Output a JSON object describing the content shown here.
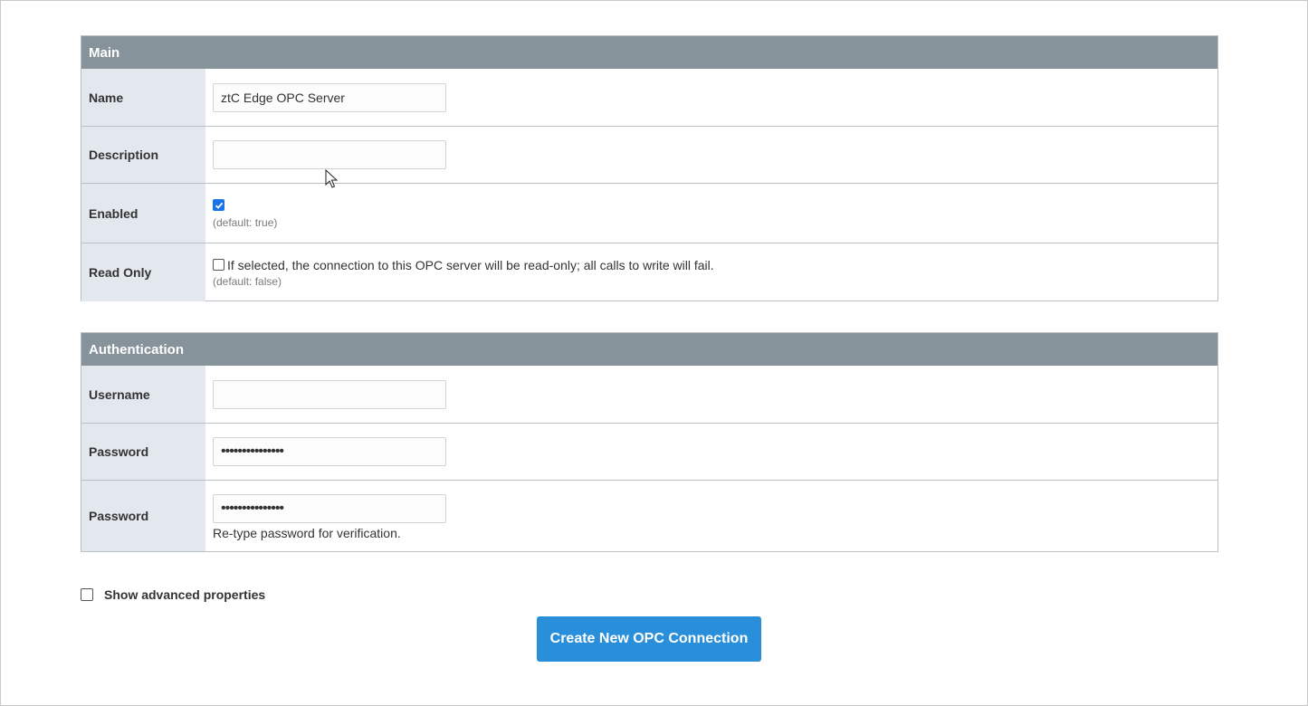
{
  "main_section": {
    "title": "Main",
    "name_label": "Name",
    "name_value": "ztC Edge OPC Server",
    "description_label": "Description",
    "description_value": "",
    "enabled_label": "Enabled",
    "enabled_checked": true,
    "enabled_default": "(default: true)",
    "read_only_label": "Read Only",
    "read_only_checked": false,
    "read_only_text": "If selected, the connection to this OPC server will be read-only; all calls to write will fail.",
    "read_only_default": "(default: false)"
  },
  "auth_section": {
    "title": "Authentication",
    "username_label": "Username",
    "username_value": "",
    "password_label": "Password",
    "password_value": "•••••••••••••••",
    "password_confirm_label": "Password",
    "password_confirm_value": "•••••••••••••••",
    "password_confirm_help": "Re-type password for verification."
  },
  "advanced": {
    "label": "Show advanced properties",
    "checked": false
  },
  "actions": {
    "create_label": "Create New OPC Connection"
  },
  "colors": {
    "header_bg": "#87939b",
    "label_bg": "#e3e8ee",
    "button_bg": "#2a8fdb",
    "checkbox_on": "#1a73e8"
  }
}
